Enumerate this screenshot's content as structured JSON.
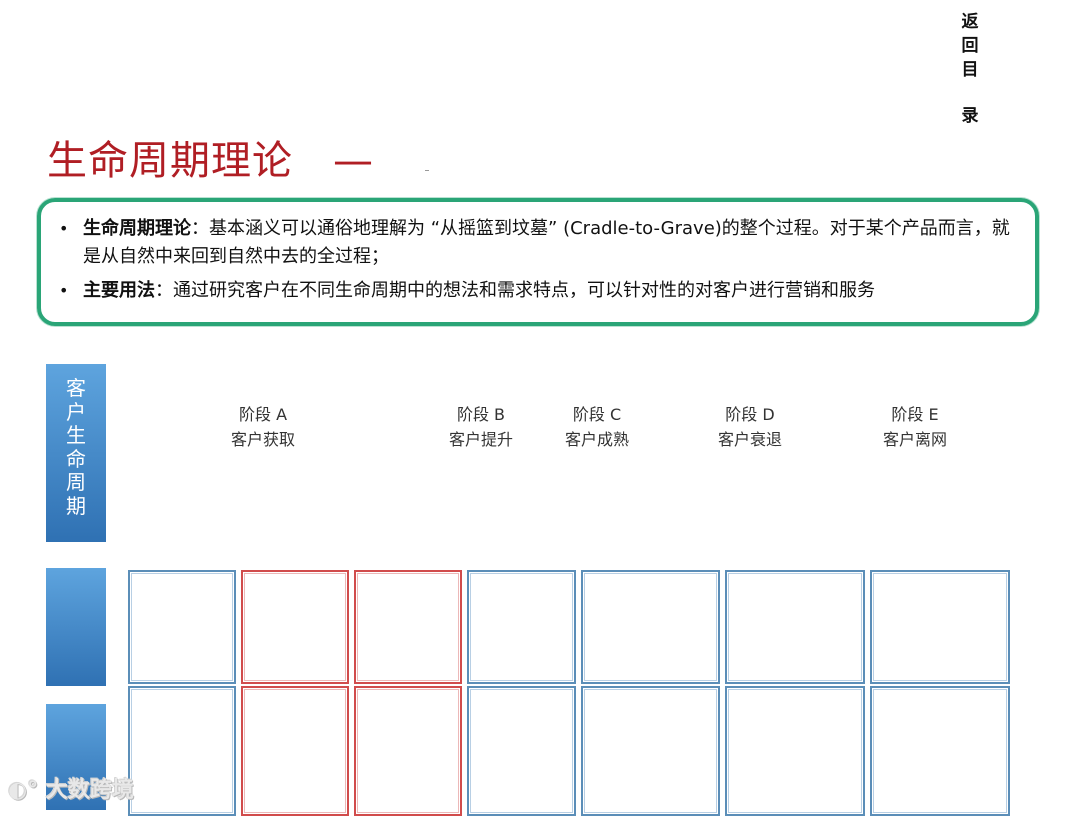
{
  "nav": {
    "back_chars": [
      "返",
      "回",
      "目",
      "录"
    ]
  },
  "title": {
    "text": "生命周期理论",
    "dash": "—"
  },
  "summary": {
    "items": [
      {
        "term": "生命周期理论",
        "text": "：基本涵义可以通俗地理解为 “从摇篮到坟墓” (Cradle-to-Grave)的整个过程。对于某个产品而言，就是从自然中来回到自然中去的全过程；"
      },
      {
        "term": "主要用法",
        "text": "：通过研究客户在不同生命周期中的想法和需求特点，可以针对性的对客户进行营销和服务"
      }
    ]
  },
  "side_label": {
    "chars": [
      "客",
      "户",
      "生",
      "命",
      "周",
      "期"
    ]
  },
  "stages": [
    {
      "name": "阶段 A",
      "desc": "客户获取"
    },
    {
      "name": "阶段 B",
      "desc": "客户提升"
    },
    {
      "name": "阶段 C",
      "desc": "客户成熟"
    },
    {
      "name": "阶段 D",
      "desc": "客户衰退"
    },
    {
      "name": "阶段 E",
      "desc": "客户离网"
    }
  ],
  "watermark": {
    "text": "大数跨境"
  },
  "colors": {
    "title": "#b01e24",
    "box_border": "#2aa577",
    "side_block": "#3b82c4",
    "cell_blue": "#5b8eb8",
    "cell_red": "#d14c4c"
  }
}
